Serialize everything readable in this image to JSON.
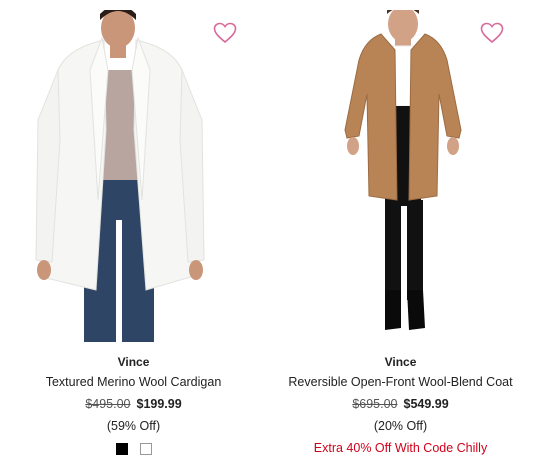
{
  "colors": {
    "heart": "#d86a9a",
    "promo": "#d0021b",
    "swatch_black": "#000000",
    "swatch_white": "#ffffff"
  },
  "products": [
    {
      "brand": "Vince",
      "name": "Textured Merino Wool Cardigan",
      "original_price": "$495.00",
      "sale_price": "$199.99",
      "discount": "(59% Off)",
      "swatches": [
        "black",
        "white"
      ],
      "favorite_icon": "heart-outline-icon"
    },
    {
      "brand": "Vince",
      "name": "Reversible Open-Front Wool-Blend Coat",
      "original_price": "$695.00",
      "sale_price": "$549.99",
      "discount": "(20% Off)",
      "promo": "Extra 40% Off With Code Chilly",
      "favorite_icon": "heart-outline-icon"
    }
  ]
}
